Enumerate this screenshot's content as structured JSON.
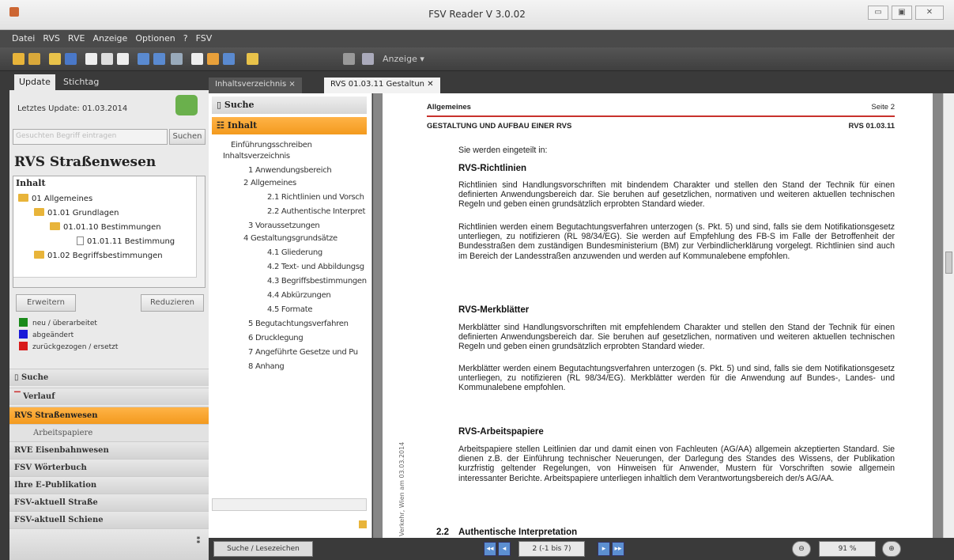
{
  "window": {
    "title": "FSV Reader V 3.0.02"
  },
  "menu": [
    "Datei",
    "RVS",
    "RVE",
    "Anzeige",
    "Optionen",
    "?",
    "FSV"
  ],
  "toolbar": {
    "anzeige_label": "Anzeige"
  },
  "left": {
    "tabs": [
      "Update",
      "Stichtag"
    ],
    "last_update": "Letztes Update: 01.03.2014",
    "search_placeholder": "Gesuchten Begriff eintragen",
    "search_button": "Suchen",
    "title": "RVS Straßenwesen",
    "tree_header": "Inhalt",
    "tree": [
      "01 Allgemeines",
      "01.01 Grundlagen",
      "01.01.10 Bestimmungen",
      "01.01.11 Bestimmung",
      "01.02 Begriffsbestimmungen"
    ],
    "expand_button": "Erweitern",
    "reduce_button": "Reduzieren",
    "legend": [
      {
        "label": "neu / überarbeitet",
        "color": "#1a8a1a"
      },
      {
        "label": "abgeändert",
        "color": "#1a1ad8"
      },
      {
        "label": "zurückgezogen / ersetzt",
        "color": "#d81a1a"
      }
    ],
    "nav": [
      "Suche",
      "Verlauf",
      "RVS Straßenwesen",
      "Arbeitspapiere",
      "RVE Eisenbahnwesen",
      "FSV Wörterbuch",
      "Ihre E-Publikation",
      "FSV-aktuell Straße",
      "FSV-aktuell Schiene"
    ]
  },
  "tabs": [
    "Inhaltsverzeichnis",
    "RVS 01.03.11 Gestaltun"
  ],
  "middle": {
    "search_header": "Suche",
    "content_header": "Inhalt",
    "toc": [
      "Einführungsschreiben",
      "Inhaltsverzeichnis",
      "1 Anwendungsbereich",
      "2 Allgemeines",
      "2.1 Richtlinien und Vorsch",
      "2.2 Authentische Interpret",
      "3 Voraussetzungen",
      "4 Gestaltungsgrundsätze",
      "4.1 Gliederung",
      "4.2 Text- und Abbildungsg",
      "4.3 Begriffsbestimmungen",
      "4.4 Abkürzungen",
      "4.5 Formate",
      "5 Begutachtungsverfahren",
      "6 Drucklegung",
      "7 Angeführte Gesetze und Pu",
      "8 Anhang"
    ]
  },
  "document": {
    "header_left": "Allgemeines",
    "header_right": "Seite 2",
    "subheader_left": "GESTALTUNG UND AUFBAU EINER RVS",
    "subheader_right": "RVS 01.03.11",
    "intro": "Sie werden eingeteilt in:",
    "h1": "RVS-Richtlinien",
    "p1": "Richtlinien sind Handlungsvorschriften mit bindendem Charakter und stellen den Stand der Technik für einen definierten Anwendungsbereich dar. Sie beruhen auf gesetzlichen, normativen und weiteren aktuellen technischen Regeln und geben einen grundsätzlich erprobten Standard wieder.",
    "p2": "Richtlinien werden einem Begutachtungsverfahren unterzogen (s. Pkt. 5) und sind, falls sie dem Notifikationsgesetz unterliegen, zu notifizieren (RL 98/34/EG). Sie werden auf Empfehlung des FB-S im Falle der Betroffenheit der Bundesstraßen dem zuständigen Bundesministerium (BM) zur Verbindlicherklärung vorgelegt. Richtlinien sind auch im Bereich der Landesstraßen anzuwenden und werden auf Kommunalebene empfohlen.",
    "h2": "RVS-Merkblätter",
    "p3": "Merkblätter sind Handlungsvorschriften mit empfehlendem Charakter und stellen den Stand der Technik für einen definierten Anwendungsbereich dar. Sie beruhen auf gesetzlichen, normativen und weiteren aktuellen technischen Regeln und geben einen grundsätzlich erprobten Standard wieder.",
    "p4": "Merkblätter werden einem Begutachtungsverfahren unterzogen (s. Pkt. 5) und sind, falls sie dem Notifikationsgesetz unterliegen, zu notifizieren (RL 98/34/EG). Merkblätter werden für die Anwendung auf Bundes-, Landes- und Kommunalebene empfohlen.",
    "h3": "RVS-Arbeitspapiere",
    "p5": "Arbeitspapiere stellen Leitlinien dar und damit einen von Fachleuten (AG/AA) allgemein akzeptierten Standard. Sie dienen z.B. der Einführung technischer Neuerungen, der Darlegung des Standes des Wissens, der Publikation kurzfristig geltender Regelungen, von Hinweisen für Anwender, Mustern für Vorschriften sowie allgemein interessanter Berichte. Arbeitspapiere unterliegen inhaltlich dem Verantwortungsbereich der/s AG/AA.",
    "h4_num": "2.2",
    "h4": "Authentische Interpretation",
    "margin_text": "Verkehr, Wien am 03.03.2014"
  },
  "bottom": {
    "search_bookmarks": "Suche / Lesezeichen",
    "page_indicator": "2 (-1 bis 7)",
    "zoom": "91 %"
  }
}
